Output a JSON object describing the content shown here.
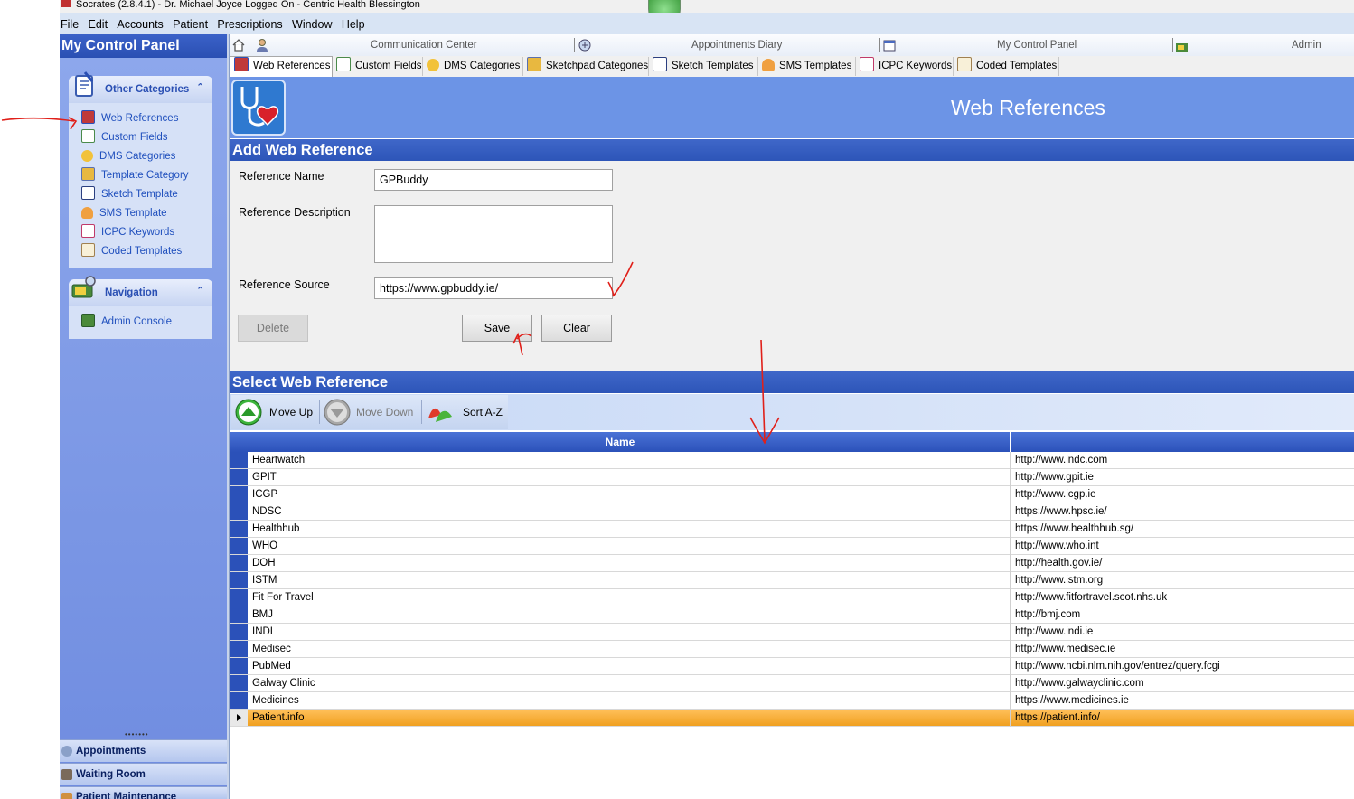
{
  "window": {
    "title": "Socrates (2.8.4.1) - Dr. Michael Joyce Logged On - Centric Health Blessington"
  },
  "menu": [
    "File",
    "Edit",
    "Accounts",
    "Patient",
    "Prescriptions",
    "Window",
    "Help"
  ],
  "left_panel": {
    "title": "My Control Panel",
    "other_categories": {
      "title": "Other Categories",
      "items": [
        "Web References",
        "Custom Fields",
        "DMS Categories",
        "Template Category",
        "Sketch Template",
        "SMS Template",
        "ICPC Keywords",
        "Coded Templates"
      ]
    },
    "navigation": {
      "title": "Navigation",
      "items": [
        "Admin Console"
      ]
    },
    "bottom_buttons": [
      "Appointments",
      "Waiting Room",
      "Patient Maintenance"
    ]
  },
  "top_nav": [
    "Communication Center",
    "Appointments Diary",
    "My Control Panel",
    "Admin Consol"
  ],
  "sub_tabs": [
    "Web References",
    "Custom Fields",
    "DMS Categories",
    "Sketchpad Categories",
    "Sketch Templates",
    "SMS Templates",
    "ICPC Keywords",
    "Coded Templates"
  ],
  "banner": {
    "title": "Web References"
  },
  "add_section": {
    "title": "Add Web Reference",
    "name_label": "Reference Name",
    "name_value": "GPBuddy",
    "desc_label": "Reference Description",
    "desc_value": "",
    "source_label": "Reference Source",
    "source_value": "https://www.gpbuddy.ie/",
    "delete_label": "Delete",
    "save_label": "Save",
    "clear_label": "Clear"
  },
  "select_section": {
    "title": "Select Web Reference",
    "move_up": "Move Up",
    "move_down": "Move Down",
    "sort": "Sort A-Z",
    "column_name": "Name",
    "rows": [
      {
        "name": "Heartwatch",
        "url": "http://www.indc.com"
      },
      {
        "name": "GPIT",
        "url": "http://www.gpit.ie"
      },
      {
        "name": "ICGP",
        "url": "http://www.icgp.ie"
      },
      {
        "name": "NDSC",
        "url": "https://www.hpsc.ie/"
      },
      {
        "name": "Healthhub",
        "url": "https://www.healthhub.sg/"
      },
      {
        "name": "WHO",
        "url": "http://www.who.int"
      },
      {
        "name": "DOH",
        "url": "http://health.gov.ie/"
      },
      {
        "name": "ISTM",
        "url": "http://www.istm.org"
      },
      {
        "name": "Fit For Travel",
        "url": "http://www.fitfortravel.scot.nhs.uk"
      },
      {
        "name": "BMJ",
        "url": "http://bmj.com"
      },
      {
        "name": "INDI",
        "url": "http://www.indi.ie"
      },
      {
        "name": "Medisec",
        "url": "http://www.medisec.ie"
      },
      {
        "name": "PubMed",
        "url": "http://www.ncbi.nlm.nih.gov/entrez/query.fcgi"
      },
      {
        "name": "Galway Clinic",
        "url": "http://www.galwayclinic.com"
      },
      {
        "name": "Medicines",
        "url": "https://www.medicines.ie"
      },
      {
        "name": "Patient.info",
        "url": "https://patient.info/"
      }
    ],
    "selected_row": "Patient.info"
  },
  "colors": {
    "accent": "#2d55b8",
    "banner": "#6c94e6",
    "selection": "#f0a020",
    "annotation": "#e0201a"
  }
}
